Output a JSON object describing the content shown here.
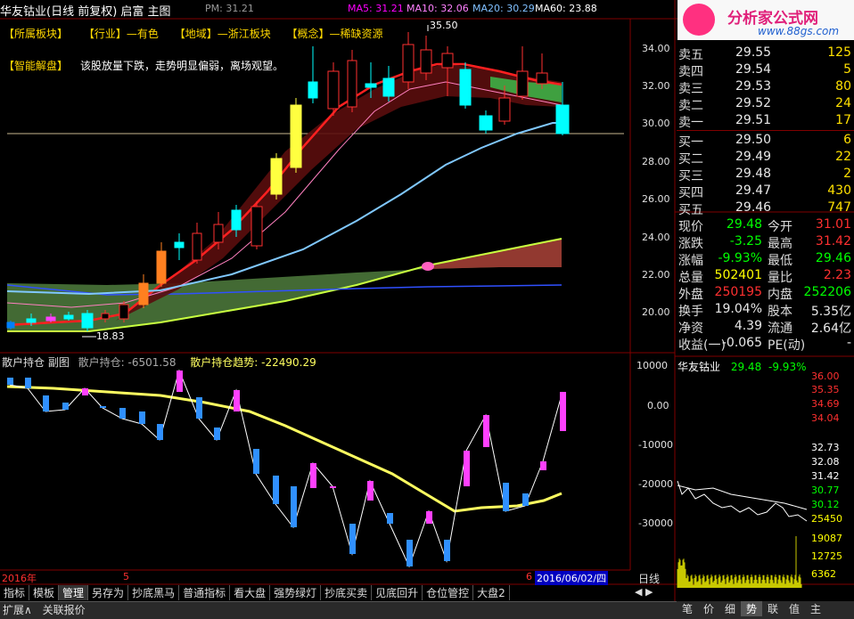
{
  "header": {
    "title": "华友钴业(日线 前复权) 启富 主图",
    "pm_label": "PM: 31.21",
    "ma": [
      {
        "label": "MA5: 31.21",
        "color": "#ff00ff"
      },
      {
        "label": "MA10: 32.06",
        "color": "#ff80ff"
      },
      {
        "label": "MA20: 30.29",
        "color": "#80c0ff"
      },
      {
        "label": "MA60: 23.88",
        "color": "#ffffff"
      }
    ],
    "logo_text": "分析家公式网",
    "logo_url": "www.88gs.com"
  },
  "tags": [
    "【所属板块】",
    "【行业】—有色",
    "【地域】—浙江板块",
    "【概念】—稀缺资源"
  ],
  "smart": {
    "label": "【智能解盘】",
    "text": "该股放量下跌，走势明显偏弱，离场观望。"
  },
  "main_chart": {
    "y_labels": [
      "34.00",
      "32.00",
      "30.00",
      "28.00",
      "26.00",
      "24.00",
      "22.00",
      "20.00"
    ],
    "high_label": "35.50",
    "low_label": "18.83"
  },
  "sub_chart": {
    "header_title": "散户持仓 副图",
    "header_value": "散户持仓: -6501.58",
    "header_trend": "散户持仓趋势: -22490.29",
    "y_labels": [
      "10000",
      "0.00",
      "-10000",
      "-20000",
      "-30000"
    ]
  },
  "x_axis": {
    "start": "2016年",
    "mid": "5",
    "mid2": "6",
    "date": "2016/06/02/四"
  },
  "order_book": {
    "sells": [
      {
        "label": "卖五",
        "price": "29.55",
        "vol": "125"
      },
      {
        "label": "卖四",
        "price": "29.54",
        "vol": "5"
      },
      {
        "label": "卖三",
        "price": "29.53",
        "vol": "80"
      },
      {
        "label": "卖二",
        "price": "29.52",
        "vol": "24"
      },
      {
        "label": "卖一",
        "price": "29.51",
        "vol": "17"
      }
    ],
    "buys": [
      {
        "label": "买一",
        "price": "29.50",
        "vol": "6"
      },
      {
        "label": "买二",
        "price": "29.49",
        "vol": "22"
      },
      {
        "label": "买三",
        "price": "29.48",
        "vol": "2"
      },
      {
        "label": "买四",
        "price": "29.47",
        "vol": "430"
      },
      {
        "label": "买五",
        "price": "29.46",
        "vol": "747"
      }
    ]
  },
  "quote": [
    {
      "l1": "现价",
      "v1": "29.48",
      "c1": "#00ff00",
      "l2": "今开",
      "v2": "31.01",
      "c2": "#ff3030"
    },
    {
      "l1": "涨跌",
      "v1": "-3.25",
      "c1": "#00ff00",
      "l2": "最高",
      "v2": "31.42",
      "c2": "#ff3030"
    },
    {
      "l1": "涨幅",
      "v1": "-9.93%",
      "c1": "#00ff00",
      "l2": "最低",
      "v2": "29.46",
      "c2": "#00ff00"
    },
    {
      "l1": "总量",
      "v1": "502401",
      "c1": "#ffff00",
      "l2": "量比",
      "v2": "2.23",
      "c2": "#ff3030"
    },
    {
      "l1": "外盘",
      "v1": "250195",
      "c1": "#ff3030",
      "l2": "内盘",
      "v2": "252206",
      "c2": "#00ff00"
    },
    {
      "l1": "换手",
      "v1": "19.04%",
      "c1": "#e8e8e8",
      "l2": "股本",
      "v2": "5.35亿",
      "c2": "#e8e8e8"
    },
    {
      "l1": "净资",
      "v1": "4.39",
      "c1": "#e8e8e8",
      "l2": "流通",
      "v2": "2.64亿",
      "c2": "#e8e8e8"
    },
    {
      "l1": "收益(一)",
      "v1": "-0.065",
      "c1": "#e8e8e8",
      "l2": "PE(动)",
      "v2": "-",
      "c2": "#e8e8e8"
    }
  ],
  "mini_chart": {
    "name": "华友钴业",
    "price": "29.48",
    "change": "-9.93%",
    "y_labels": [
      "36.00",
      "35.35",
      "34.69",
      "34.04",
      "32.73",
      "32.08",
      "31.42",
      "30.77",
      "30.12",
      "25450",
      "19087",
      "12725",
      "6362"
    ]
  },
  "bottom_tabs": [
    "指标",
    "模板",
    "管理",
    "另存为",
    "抄底黑马",
    "普通指标",
    "看大盘",
    "强势绿灯",
    "抄底买卖",
    "见底回升",
    "仓位管控",
    "大盘2"
  ],
  "right_tab_label": "日线",
  "status": {
    "expand": "扩展∧",
    "linked": "关联报价"
  },
  "right_tabs": [
    "笔",
    "价",
    "细",
    "势",
    "联",
    "值",
    "主"
  ]
}
